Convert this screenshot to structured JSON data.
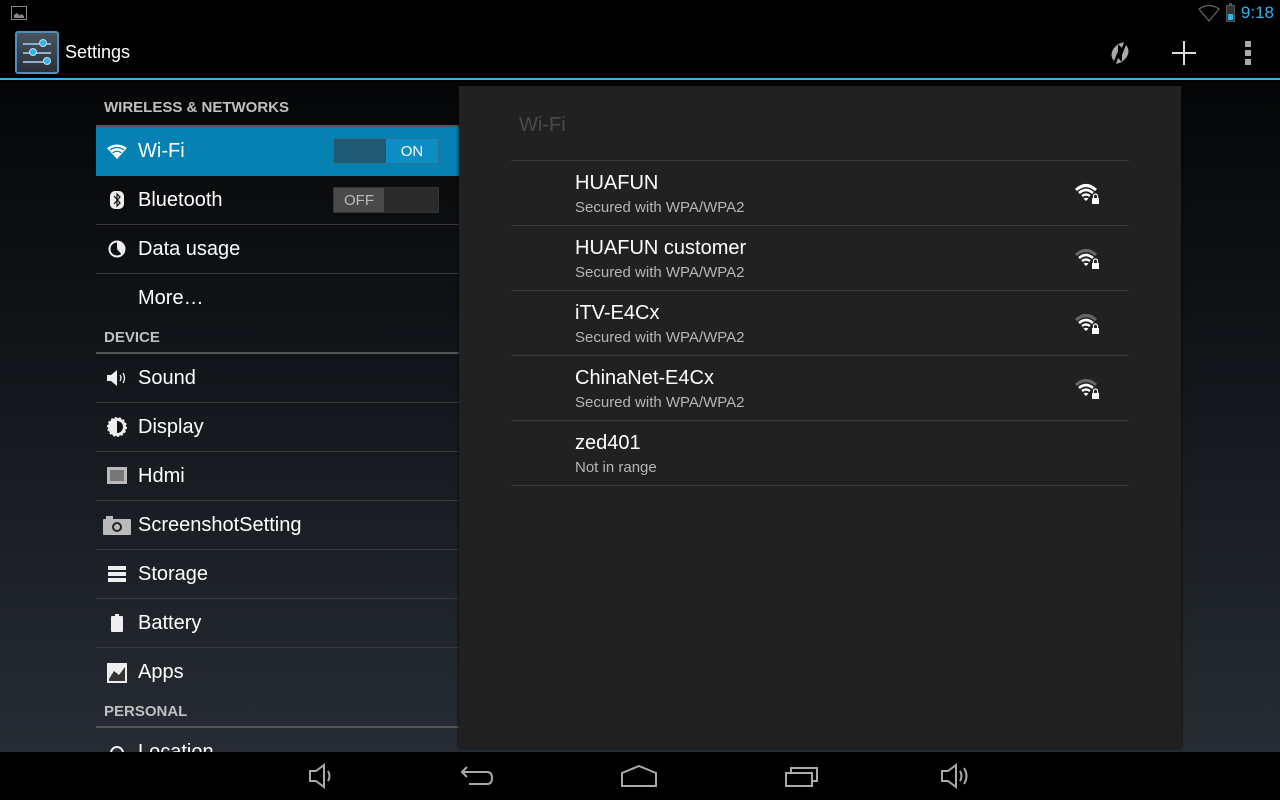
{
  "status_bar": {
    "time": "9:18",
    "icons": [
      "notification-image-icon",
      "wifi-signal-icon",
      "battery-icon"
    ]
  },
  "action_bar": {
    "title": "Settings",
    "app_icon": "settings-sliders-icon",
    "actions": [
      {
        "name": "scan",
        "icon": "refresh-scan-icon"
      },
      {
        "name": "add-network",
        "icon": "plus-icon"
      },
      {
        "name": "overflow-menu",
        "icon": "more-vert-icon"
      }
    ]
  },
  "sidebar": {
    "sections": [
      {
        "header": "WIRELESS & NETWORKS",
        "items": [
          {
            "label": "Wi-Fi",
            "icon": "wifi-icon",
            "active": true,
            "toggle": "ON"
          },
          {
            "label": "Bluetooth",
            "icon": "bluetooth-icon",
            "toggle": "OFF"
          },
          {
            "label": "Data usage",
            "icon": "data-usage-icon"
          },
          {
            "label": "More…",
            "icon": ""
          }
        ]
      },
      {
        "header": "DEVICE",
        "items": [
          {
            "label": "Sound",
            "icon": "speaker-icon"
          },
          {
            "label": "Display",
            "icon": "brightness-icon"
          },
          {
            "label": "Hdmi",
            "icon": "hdmi-icon"
          },
          {
            "label": "ScreenshotSetting",
            "icon": "camera-icon"
          },
          {
            "label": "Storage",
            "icon": "storage-icon"
          },
          {
            "label": "Battery",
            "icon": "battery-icon"
          },
          {
            "label": "Apps",
            "icon": "apps-icon"
          }
        ]
      },
      {
        "header": "PERSONAL",
        "items": [
          {
            "label": "Location",
            "icon": "location-icon"
          }
        ]
      }
    ]
  },
  "detail": {
    "title": "Wi-Fi",
    "networks": [
      {
        "ssid": "HUAFUN",
        "status": "Secured with WPA/WPA2",
        "signal_bars": 4,
        "signal_max": 4,
        "secured": true
      },
      {
        "ssid": "HUAFUN customer",
        "status": "Secured with WPA/WPA2",
        "signal_bars": 3,
        "signal_max": 4,
        "secured": true
      },
      {
        "ssid": "iTV-E4Cx",
        "status": "Secured with WPA/WPA2",
        "signal_bars": 3,
        "signal_max": 4,
        "secured": true
      },
      {
        "ssid": "ChinaNet-E4Cx",
        "status": "Secured with WPA/WPA2",
        "signal_bars": 3,
        "signal_max": 4,
        "secured": true
      },
      {
        "ssid": "zed401",
        "status": "Not in range",
        "signal_bars": 0,
        "signal_max": 4,
        "secured": false
      }
    ]
  },
  "nav_bar": {
    "buttons": [
      "volume-down-icon",
      "back-icon",
      "home-icon",
      "recent-apps-icon",
      "volume-up-icon"
    ]
  },
  "colors": {
    "accent": "#33b5e5",
    "active_item": "#0581b4",
    "panel": "#212121"
  }
}
